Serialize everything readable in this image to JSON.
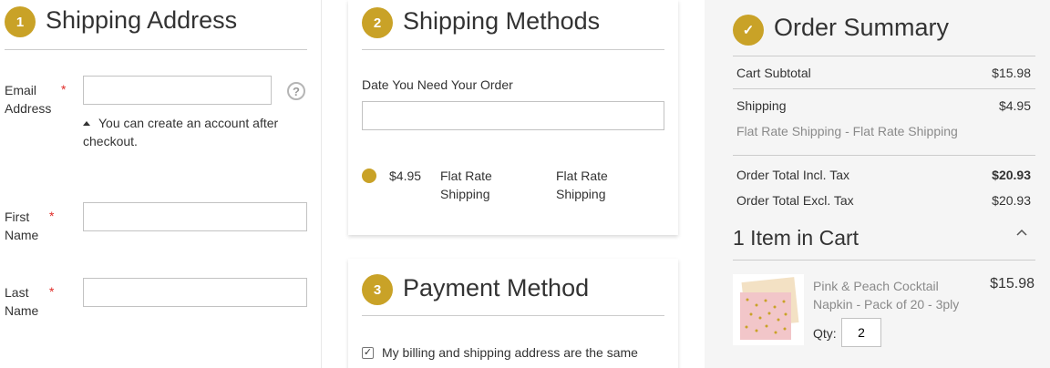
{
  "shipping_address": {
    "step": "1",
    "title": "Shipping Address",
    "email_label": "Email Address",
    "email_value": "",
    "required_mark": "*",
    "help_icon": "question-icon",
    "account_note": "You can create an account after checkout.",
    "first_name_label": "First Name",
    "first_name_value": "",
    "last_name_label": "Last Name",
    "last_name_value": ""
  },
  "shipping_methods": {
    "step": "2",
    "title": "Shipping Methods",
    "date_label": "Date You Need Your Order",
    "date_value": "",
    "method_price": "$4.95",
    "method_title": "Flat Rate Shipping",
    "carrier_title": "Flat Rate Shipping"
  },
  "payment_method": {
    "step": "3",
    "title": "Payment Method",
    "same_address_label": "My billing and shipping address are the same",
    "same_address_checked": true
  },
  "order_summary": {
    "badge": "✓",
    "title": "Order Summary",
    "subtotal_label": "Cart Subtotal",
    "subtotal_value": "$15.98",
    "shipping_label": "Shipping",
    "shipping_value": "$4.95",
    "shipping_method": "Flat Rate Shipping - Flat Rate Shipping",
    "total_incl_label": "Order Total Incl. Tax",
    "total_incl_value": "$20.93",
    "total_excl_label": "Order Total Excl. Tax",
    "total_excl_value": "$20.93",
    "items_heading": "1 Item in Cart",
    "collapse_icon": "chevron-up-icon",
    "item": {
      "name": "Pink & Peach Cocktail Napkin - Pack of 20 - 3ply",
      "price": "$15.98",
      "qty_label": "Qty:",
      "qty_value": "2"
    }
  },
  "colors": {
    "accent": "#c9a227",
    "required": "#e02b27",
    "summary_bg": "#f5f5f5"
  }
}
